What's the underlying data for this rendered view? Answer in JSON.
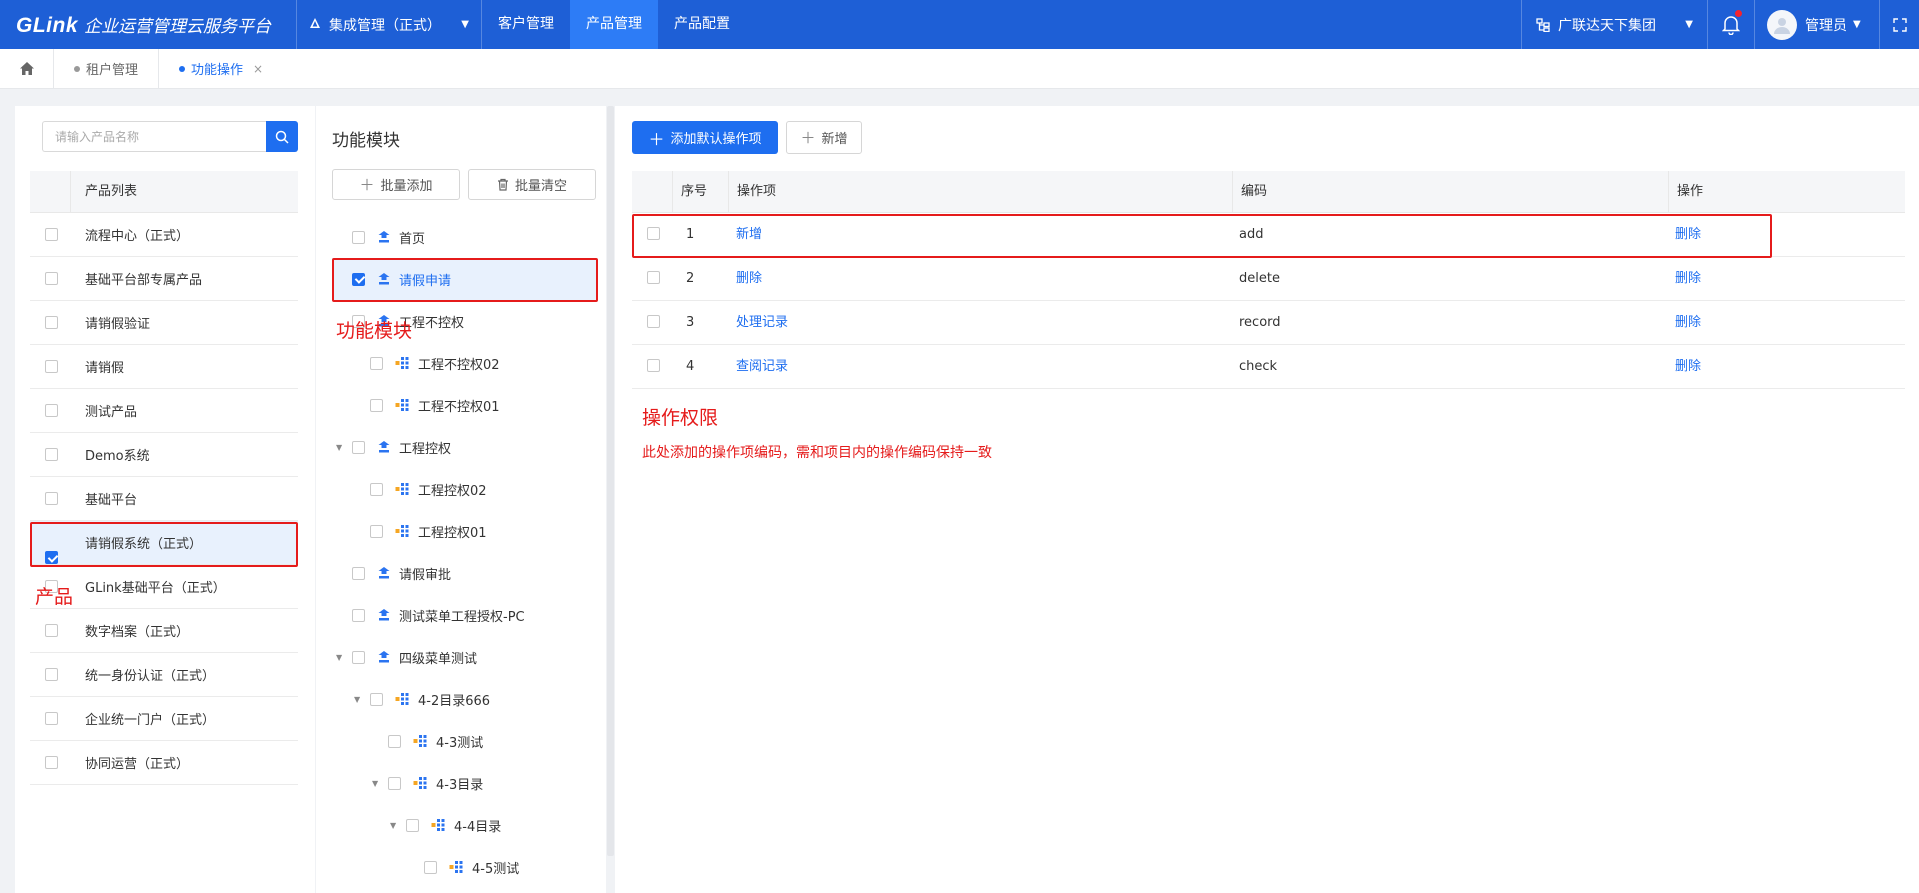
{
  "topbar": {
    "logo": "GLink",
    "platform_title": "企业运营管理云服务平台",
    "system_select": "集成管理（正式）",
    "menu": [
      "客户管理",
      "产品管理",
      "产品配置"
    ],
    "active_menu": "产品管理",
    "org": "广联达天下集团",
    "user": "管理员",
    "notification_unread": true
  },
  "tabs": [
    {
      "label": "租户管理",
      "active": false
    },
    {
      "label": "功能操作",
      "active": true,
      "close": "×"
    }
  ],
  "products": {
    "search_placeholder": "请输入产品名称",
    "header": "产品列表",
    "items": [
      {
        "label": "流程中心（正式）",
        "checked": false
      },
      {
        "label": "基础平台部专属产品",
        "checked": false
      },
      {
        "label": "请销假验证",
        "checked": false
      },
      {
        "label": "请销假",
        "checked": false
      },
      {
        "label": "测试产品",
        "checked": false
      },
      {
        "label": "Demo系统",
        "checked": false
      },
      {
        "label": "基础平台",
        "checked": false
      },
      {
        "label": "请销假系统（正式）",
        "checked": true
      },
      {
        "label": "GLink基础平台（正式）",
        "checked": false
      },
      {
        "label": "数字档案（正式）",
        "checked": false
      },
      {
        "label": "统一身份认证（正式）",
        "checked": false
      },
      {
        "label": "企业统一门户（正式）",
        "checked": false
      },
      {
        "label": "协同运营（正式）",
        "checked": false
      }
    ]
  },
  "modules": {
    "title": "功能模块",
    "batch_add": "批量添加",
    "batch_clear": "批量清空",
    "tree": [
      {
        "label": "首页",
        "level": 0,
        "type": "module",
        "checked": false
      },
      {
        "label": "请假申请",
        "level": 0,
        "type": "module",
        "checked": true
      },
      {
        "label": "工程不控权",
        "level": 0,
        "type": "module",
        "checked": false
      },
      {
        "label": "工程不控权02",
        "level": 1,
        "type": "page",
        "checked": false
      },
      {
        "label": "工程不控权01",
        "level": 1,
        "type": "page",
        "checked": false
      },
      {
        "label": "工程控权",
        "level": 0,
        "type": "module",
        "checked": false,
        "expanded": true
      },
      {
        "label": "工程控权02",
        "level": 1,
        "type": "page",
        "checked": false
      },
      {
        "label": "工程控权01",
        "level": 1,
        "type": "page",
        "checked": false
      },
      {
        "label": "请假审批",
        "level": 0,
        "type": "module",
        "checked": false
      },
      {
        "label": "测试菜单工程授权-PC",
        "level": 0,
        "type": "module",
        "checked": false
      },
      {
        "label": "四级菜单测试",
        "level": 0,
        "type": "module",
        "checked": false,
        "expanded": true
      },
      {
        "label": "4-2目录666",
        "level": 1,
        "type": "page",
        "checked": false,
        "expanded": true
      },
      {
        "label": "4-3测试",
        "level": 2,
        "type": "page",
        "checked": false
      },
      {
        "label": "4-3目录",
        "level": 2,
        "type": "page",
        "checked": false,
        "expanded": true
      },
      {
        "label": "4-4目录",
        "level": 3,
        "type": "page",
        "checked": false,
        "expanded": true
      },
      {
        "label": "4-5测试",
        "level": 4,
        "type": "page",
        "checked": false
      }
    ]
  },
  "operations": {
    "add_default": "添加默认操作项",
    "add_new": "新增",
    "columns": [
      "序号",
      "操作项",
      "编码",
      "操作"
    ],
    "rows": [
      {
        "no": "1",
        "name": "新增",
        "code": "add",
        "action": "删除"
      },
      {
        "no": "2",
        "name": "删除",
        "code": "delete",
        "action": "删除"
      },
      {
        "no": "3",
        "name": "处理记录",
        "code": "record",
        "action": "删除"
      },
      {
        "no": "4",
        "name": "查阅记录",
        "code": "check",
        "action": "删除"
      }
    ]
  },
  "annotations": {
    "product": "产品",
    "module": "功能模块",
    "permission": "操作权限",
    "note": "此处添加的操作项编码，需和项目内的操作编码保持一致"
  },
  "colors": {
    "primary": "#1e6ef0",
    "topbar": "#1e5fd6",
    "annotation": "#e51b1b"
  }
}
